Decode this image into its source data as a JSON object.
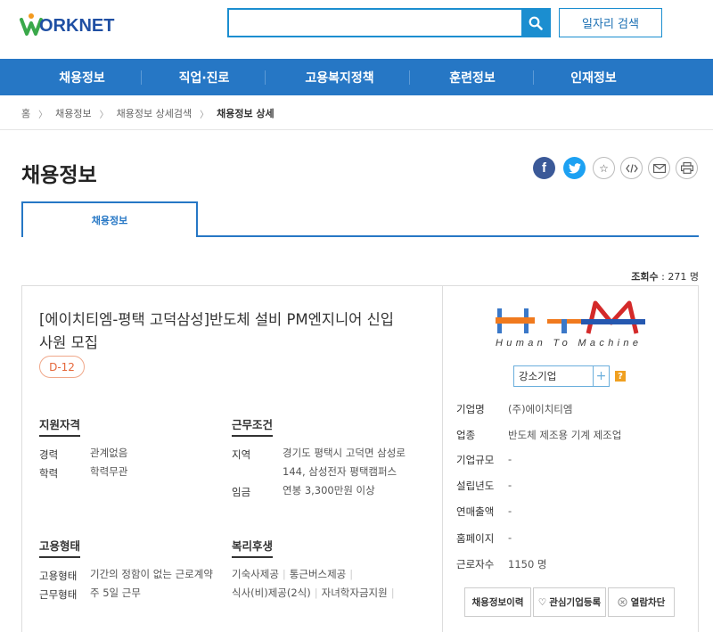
{
  "header": {
    "logo_text": "ORKNET",
    "search": {
      "value": "",
      "placeholder": ""
    },
    "job_search_label": "일자리 검색"
  },
  "gnb": [
    "채용정보",
    "직업·진로",
    "고용복지정책",
    "훈련정보",
    "인재정보"
  ],
  "breadcrumb": [
    "홈",
    "채용정보",
    "채용정보 상세검색",
    "채용정보 상세"
  ],
  "page_title": "채용정보",
  "tab_label": "채용정보",
  "views": {
    "label": "조회수",
    "value": "271 명"
  },
  "job": {
    "title_line1": "[에이치티엠-평택 고덕삼성]반도체 설비 PM엔지니어 신입",
    "title_line2": "사원 모집",
    "dday": "D-12"
  },
  "qualification": {
    "title": "지원자격",
    "rows": [
      {
        "label": "경력",
        "value": "관계없음"
      },
      {
        "label": "학력",
        "value": "학력무관"
      }
    ]
  },
  "conditions": {
    "title": "근무조건",
    "region_label": "지역",
    "region_line1": "경기도 평택시 고덕면 삼성로",
    "region_line2": "144, 삼성전자 평택캠퍼스",
    "wage_label": "임금",
    "wage_value": "연봉 3,300만원 이상"
  },
  "employment": {
    "title": "고용형태",
    "rows": [
      {
        "label": "고용형태",
        "value": "기간의 정함이 없는 근로계약"
      },
      {
        "label": "근무형태",
        "value": "주 5일 근무"
      }
    ]
  },
  "welfare": {
    "title": "복리후생",
    "items_line1": [
      "기숙사제공",
      "통근버스제공"
    ],
    "items_line2": [
      "식사(비)제공(2식)",
      "자녀학자금지원"
    ]
  },
  "company": {
    "logo_letters": "HTM",
    "logo_caption": "Human To Machine",
    "tag": "강소기업",
    "tag_help": "?",
    "info": [
      {
        "label": "기업명",
        "value": "(주)에이치티엠"
      },
      {
        "label": "업종",
        "value": "반도체 제조용 기계 제조업"
      },
      {
        "label": "기업규모",
        "value": "-"
      },
      {
        "label": "설립년도",
        "value": "-"
      },
      {
        "label": "연매출액",
        "value": "-"
      },
      {
        "label": "홈페이지",
        "value": "-"
      },
      {
        "label": "근로자수",
        "value": "1150 명"
      }
    ],
    "buttons": [
      "채용정보이력",
      "관심기업등록",
      "열람차단"
    ]
  },
  "colors": {
    "primary": "#2677c5",
    "accent": "#1b8ed0",
    "dday": "#e5673a"
  }
}
